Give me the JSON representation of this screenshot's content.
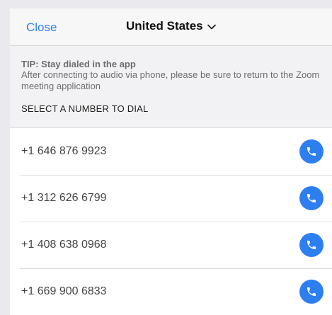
{
  "navbar": {
    "close_label": "Close",
    "country": "United States"
  },
  "tip": {
    "title": "TIP: Stay dialed in the app",
    "body": "After connecting to audio via phone, please be sure to return to the Zoom meeting application"
  },
  "section_header": "SELECT A NUMBER TO DIAL",
  "numbers": [
    {
      "number": "+1 646 876 9923",
      "icon": "phone-icon"
    },
    {
      "number": "+1 312 626 6799",
      "icon": "phone-icon"
    },
    {
      "number": "+1 408 638 0968",
      "icon": "phone-icon"
    },
    {
      "number": "+1 669 900 6833",
      "icon": "phone-icon"
    }
  ],
  "colors": {
    "accent": "#2d7ff0",
    "background": "#f2f2f4"
  }
}
